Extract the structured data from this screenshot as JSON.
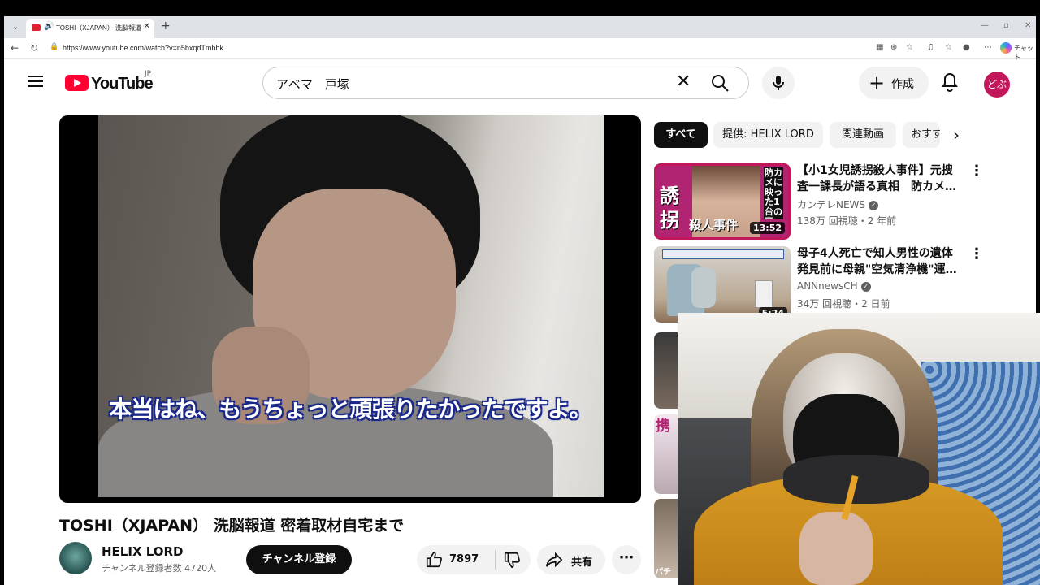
{
  "browser": {
    "tab_title": "TOSHI（XJAPAN） 洗脳報道 密着取材自宅まで",
    "url": "https://www.youtube.com/watch?v=n5bxqdTmbhk",
    "chat_label": "チャット"
  },
  "header": {
    "logo_text": "YouTube",
    "logo_region": "JP",
    "search_value": "アベマ　戸塚",
    "create_label": "作成",
    "avatar_text": "どぶ"
  },
  "video": {
    "subtitle": "本当はね、もうちょっと頑張りたかったですよ。",
    "title": "TOSHI（XJAPAN） 洗脳報道 密着取材自宅まで",
    "channel_name": "HELIX LORD",
    "channel_subs": "チャンネル登録者数 4720人",
    "subscribe_label": "チャンネル登録",
    "like_count": "7897",
    "share_label": "共有"
  },
  "chips": [
    "すべて",
    "提供: HELIX LORD",
    "関連動画",
    "おすすめ"
  ],
  "recommendations": [
    {
      "thumb_text_left": "誘\n拐",
      "thumb_text_vertical": "防カメに映った1台の車",
      "thumb_text_band": "殺人事件",
      "duration": "13:52",
      "title": "【小1女児誘拐殺人事件】元捜査一課長が語る真相　防カメ…",
      "channel": "カンテレNEWS",
      "meta": "138万 回視聴・2 年前"
    },
    {
      "duration": "5:24",
      "title": "母子4人死亡で知人男性の遺体発見前に母親\"空気清浄機\"運…",
      "channel": "ANNnewsCH",
      "meta": "34万 回視聴・2 日前"
    }
  ],
  "partials": {
    "p2_text": "携",
    "p3_text": "パチ"
  }
}
